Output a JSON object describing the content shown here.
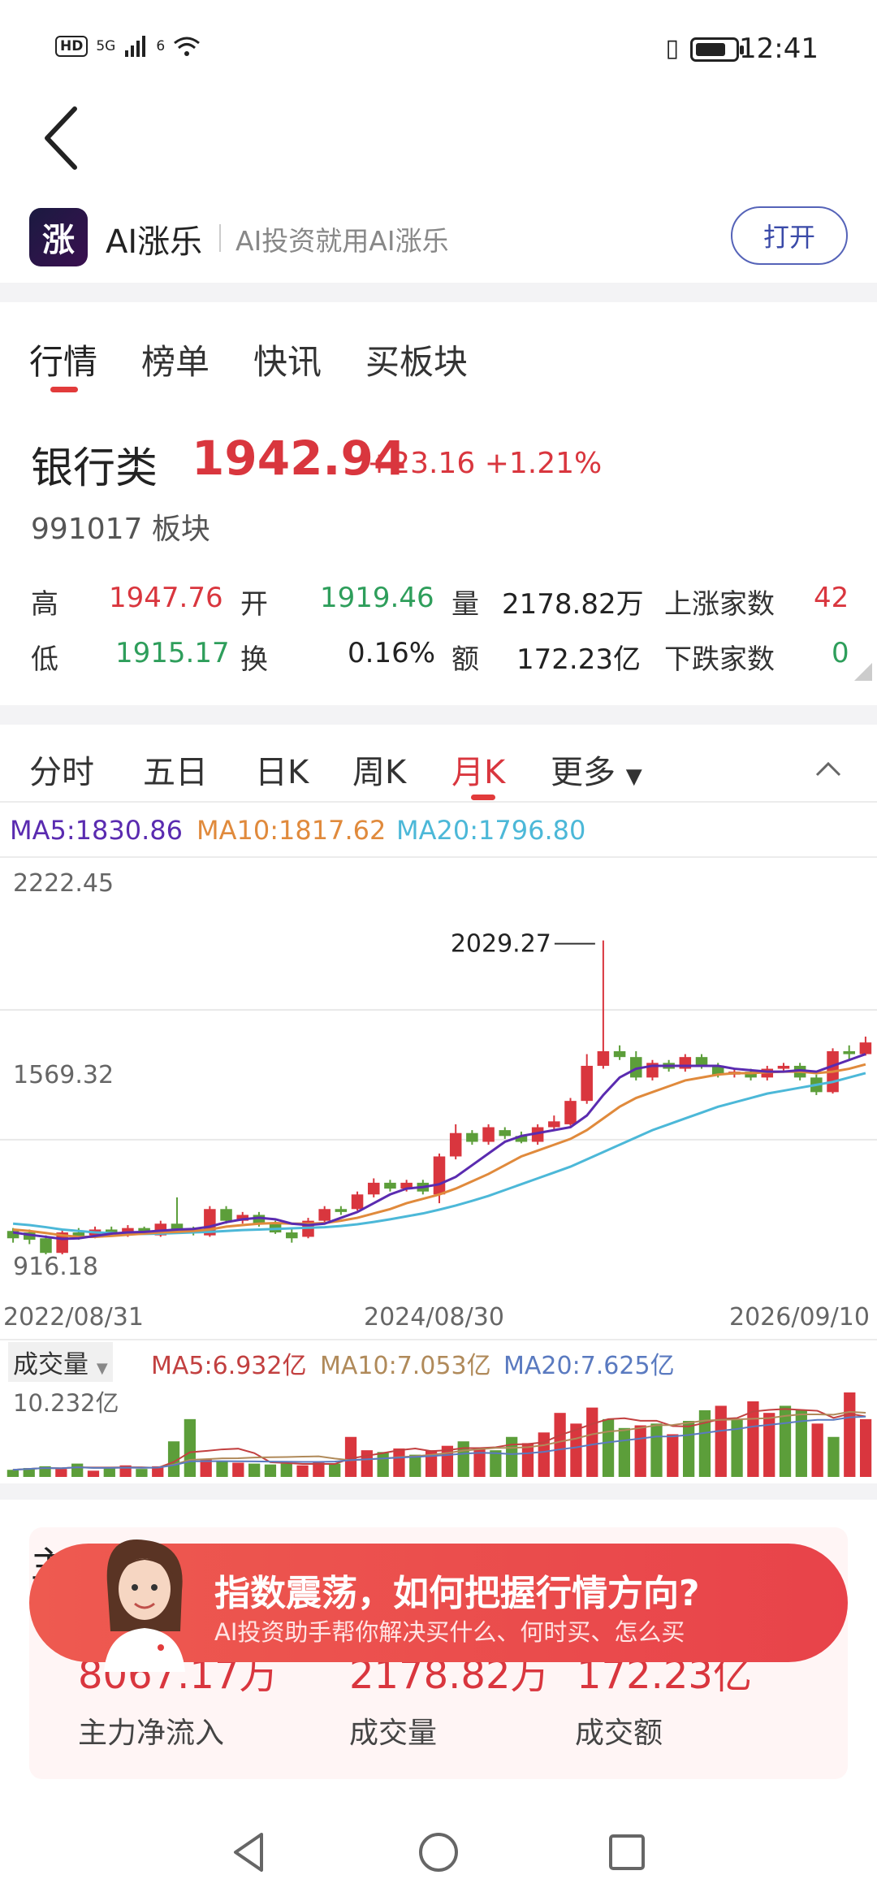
{
  "status_bar": {
    "hd": "HD",
    "signal": "5G",
    "wifi": "6",
    "time": "12:41",
    "icons": [
      "signal-icon",
      "wifi-icon",
      "vibrate-icon",
      "battery-icon"
    ]
  },
  "app": {
    "logo_char": "涨",
    "name": "AI涨乐",
    "slogan": "AI投资就用AI涨乐",
    "open_label": "打开"
  },
  "main_tabs": [
    "行情",
    "榜单",
    "快讯",
    "买板块"
  ],
  "quote": {
    "name": "银行类",
    "price": "1942.94",
    "change": "+23.16",
    "change_pct": "+1.21%",
    "code": "991017 板块",
    "stats": {
      "high_label": "高",
      "high": "1947.76",
      "open_label": "开",
      "open": "1919.46",
      "vol_label": "量",
      "vol": "2178.82万",
      "up_label": "上涨家数",
      "up": "42",
      "low_label": "低",
      "low": "1915.17",
      "turnover_label": "换",
      "turnover": "0.16%",
      "amount_label": "额",
      "amount": "172.23亿",
      "down_label": "下跌家数",
      "down": "0"
    }
  },
  "chart_tabs": [
    "分时",
    "五日",
    "日K",
    "周K",
    "月K",
    "更多"
  ],
  "ma": {
    "ma5": "MA5:1830.86",
    "ma10": "MA10:1817.62",
    "ma20": "MA20:1796.80"
  },
  "colors": {
    "up": "#d9363e",
    "down": "#5c9e3a",
    "ma5": "#5a2bb0",
    "ma10": "#e08a3c",
    "ma20": "#4cb8d8"
  },
  "chart_data": {
    "type": "candlestick",
    "price_axis_labels": [
      "2222.45",
      "1569.32",
      "916.18"
    ],
    "ylim": [
      916.18,
      2222.45
    ],
    "x_labels": [
      "2022/08/31",
      "2024/08/30",
      "2026/09/10"
    ],
    "max_annotation": "2029.27",
    "candles": [
      {
        "o": 1035,
        "c": 1010,
        "h": 1045,
        "l": 995
      },
      {
        "o": 1030,
        "c": 1005,
        "h": 1040,
        "l": 990
      },
      {
        "o": 1010,
        "c": 960,
        "h": 1020,
        "l": 955
      },
      {
        "o": 960,
        "c": 1030,
        "h": 1040,
        "l": 955
      },
      {
        "o": 1030,
        "c": 1015,
        "h": 1045,
        "l": 1005
      },
      {
        "o": 1020,
        "c": 1040,
        "h": 1050,
        "l": 1010
      },
      {
        "o": 1040,
        "c": 1025,
        "h": 1050,
        "l": 1015
      },
      {
        "o": 1025,
        "c": 1045,
        "h": 1055,
        "l": 1015
      },
      {
        "o": 1045,
        "c": 1035,
        "h": 1050,
        "l": 1025
      },
      {
        "o": 1020,
        "c": 1060,
        "h": 1070,
        "l": 1015
      },
      {
        "o": 1060,
        "c": 1040,
        "h": 1150,
        "l": 1030
      },
      {
        "o": 1040,
        "c": 1030,
        "h": 1050,
        "l": 1020
      },
      {
        "o": 1020,
        "c": 1110,
        "h": 1120,
        "l": 1015
      },
      {
        "o": 1110,
        "c": 1070,
        "h": 1120,
        "l": 1060
      },
      {
        "o": 1070,
        "c": 1090,
        "h": 1100,
        "l": 1060
      },
      {
        "o": 1090,
        "c": 1060,
        "h": 1100,
        "l": 1050
      },
      {
        "o": 1060,
        "c": 1030,
        "h": 1070,
        "l": 1025
      },
      {
        "o": 1030,
        "c": 1010,
        "h": 1040,
        "l": 995
      },
      {
        "o": 1015,
        "c": 1070,
        "h": 1080,
        "l": 1010
      },
      {
        "o": 1070,
        "c": 1110,
        "h": 1120,
        "l": 1065
      },
      {
        "o": 1110,
        "c": 1100,
        "h": 1120,
        "l": 1090
      },
      {
        "o": 1110,
        "c": 1160,
        "h": 1170,
        "l": 1105
      },
      {
        "o": 1160,
        "c": 1200,
        "h": 1215,
        "l": 1150
      },
      {
        "o": 1200,
        "c": 1180,
        "h": 1210,
        "l": 1170
      },
      {
        "o": 1180,
        "c": 1200,
        "h": 1210,
        "l": 1170
      },
      {
        "o": 1200,
        "c": 1170,
        "h": 1210,
        "l": 1160
      },
      {
        "o": 1160,
        "c": 1290,
        "h": 1300,
        "l": 1130
      },
      {
        "o": 1290,
        "c": 1370,
        "h": 1400,
        "l": 1280
      },
      {
        "o": 1370,
        "c": 1340,
        "h": 1380,
        "l": 1330
      },
      {
        "o": 1340,
        "c": 1390,
        "h": 1400,
        "l": 1330
      },
      {
        "o": 1380,
        "c": 1360,
        "h": 1390,
        "l": 1350
      },
      {
        "o": 1360,
        "c": 1340,
        "h": 1375,
        "l": 1335
      },
      {
        "o": 1340,
        "c": 1390,
        "h": 1400,
        "l": 1330
      },
      {
        "o": 1390,
        "c": 1410,
        "h": 1430,
        "l": 1380
      },
      {
        "o": 1400,
        "c": 1480,
        "h": 1490,
        "l": 1395
      },
      {
        "o": 1480,
        "c": 1600,
        "h": 1640,
        "l": 1470
      },
      {
        "o": 1600,
        "c": 1650,
        "h": 2029,
        "l": 1590
      },
      {
        "o": 1650,
        "c": 1630,
        "h": 1670,
        "l": 1620
      },
      {
        "o": 1630,
        "c": 1560,
        "h": 1650,
        "l": 1550
      },
      {
        "o": 1560,
        "c": 1610,
        "h": 1620,
        "l": 1550
      },
      {
        "o": 1610,
        "c": 1590,
        "h": 1620,
        "l": 1580
      },
      {
        "o": 1590,
        "c": 1630,
        "h": 1640,
        "l": 1580
      },
      {
        "o": 1630,
        "c": 1600,
        "h": 1640,
        "l": 1590
      },
      {
        "o": 1600,
        "c": 1570,
        "h": 1610,
        "l": 1560
      },
      {
        "o": 1570,
        "c": 1580,
        "h": 1590,
        "l": 1560
      },
      {
        "o": 1580,
        "c": 1560,
        "h": 1590,
        "l": 1550
      },
      {
        "o": 1560,
        "c": 1590,
        "h": 1600,
        "l": 1550
      },
      {
        "o": 1590,
        "c": 1600,
        "h": 1610,
        "l": 1580
      },
      {
        "o": 1600,
        "c": 1560,
        "h": 1610,
        "l": 1550
      },
      {
        "o": 1560,
        "c": 1510,
        "h": 1570,
        "l": 1500
      },
      {
        "o": 1510,
        "c": 1650,
        "h": 1660,
        "l": 1505
      },
      {
        "o": 1650,
        "c": 1640,
        "h": 1670,
        "l": 1620
      },
      {
        "o": 1640,
        "c": 1680,
        "h": 1700,
        "l": 1635
      }
    ],
    "ma5": [
      1030,
      1022,
      1015,
      1008,
      1010,
      1018,
      1026,
      1030,
      1032,
      1036,
      1040,
      1042,
      1050,
      1065,
      1075,
      1080,
      1075,
      1060,
      1055,
      1060,
      1080,
      1100,
      1130,
      1160,
      1180,
      1185,
      1195,
      1220,
      1260,
      1300,
      1340,
      1360,
      1370,
      1380,
      1390,
      1430,
      1500,
      1560,
      1590,
      1600,
      1600,
      1600,
      1600,
      1600,
      1590,
      1585,
      1580,
      1580,
      1585,
      1580,
      1600,
      1620,
      1640
    ],
    "ma10": [
      1040,
      1035,
      1028,
      1020,
      1015,
      1015,
      1018,
      1022,
      1026,
      1030,
      1032,
      1035,
      1040,
      1050,
      1055,
      1060,
      1062,
      1060,
      1060,
      1062,
      1070,
      1080,
      1095,
      1110,
      1130,
      1145,
      1160,
      1180,
      1205,
      1230,
      1260,
      1290,
      1310,
      1330,
      1350,
      1380,
      1420,
      1460,
      1490,
      1510,
      1530,
      1550,
      1560,
      1570,
      1575,
      1575,
      1578,
      1580,
      1580,
      1575,
      1580,
      1590,
      1605
    ],
    "ma20": [
      1060,
      1055,
      1048,
      1040,
      1035,
      1030,
      1028,
      1026,
      1025,
      1026,
      1028,
      1030,
      1032,
      1035,
      1038,
      1040,
      1042,
      1044,
      1046,
      1048,
      1052,
      1058,
      1066,
      1075,
      1085,
      1095,
      1108,
      1122,
      1138,
      1155,
      1175,
      1195,
      1215,
      1235,
      1255,
      1280,
      1305,
      1330,
      1355,
      1380,
      1400,
      1420,
      1440,
      1460,
      1475,
      1490,
      1505,
      1515,
      1525,
      1535,
      1545,
      1560,
      1575
    ]
  },
  "volume": {
    "tag": "成交量",
    "ma5": "MA5:6.932亿",
    "ma10": "MA10:7.053亿",
    "ma20": "MA20:7.625亿",
    "max_label": "10.232亿",
    "ylim": [
      0,
      10.232
    ],
    "values": [
      0.8,
      1.0,
      1.2,
      0.9,
      1.5,
      0.7,
      1.0,
      1.3,
      0.9,
      1.2,
      4.0,
      6.5,
      2.0,
      1.8,
      1.6,
      1.5,
      1.4,
      1.5,
      1.3,
      1.6,
      1.5,
      4.5,
      3.0,
      2.8,
      3.2,
      2.5,
      3.0,
      3.5,
      4.0,
      3.2,
      3.0,
      4.5,
      3.8,
      5.0,
      7.2,
      6.0,
      7.8,
      6.5,
      5.5,
      5.8,
      6.0,
      4.8,
      6.3,
      7.5,
      8.0,
      6.5,
      8.5,
      7.2,
      8.0,
      7.5,
      6.0,
      4.5,
      9.5,
      6.5
    ]
  },
  "card": {
    "peek_title": "主力净流入",
    "net_inflow": "8067.17万",
    "net_inflow_label": "主力净流入",
    "volume": "2178.82万",
    "volume_label": "成交量",
    "amount": "172.23亿",
    "amount_label": "成交额",
    "banner_title": "指数震荡，如何把握行情方向?",
    "banner_sub": "AI投资助手帮你解决买什么、何时买、怎么买"
  }
}
